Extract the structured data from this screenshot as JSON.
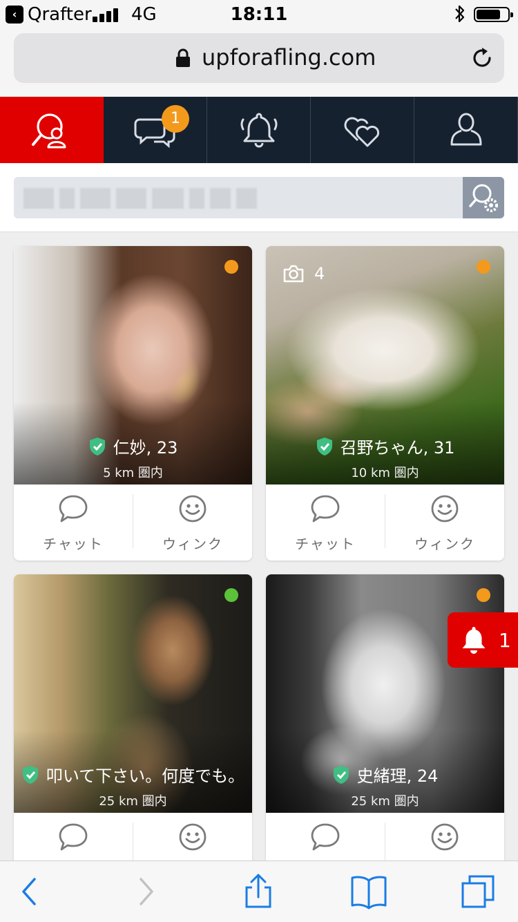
{
  "status_bar": {
    "back_app": "Qrafter",
    "network": "4G",
    "time": "18:11",
    "battery_level": 0.75
  },
  "browser": {
    "url": "upforafling.com"
  },
  "nav": {
    "tabs": [
      {
        "icon": "search-user-icon",
        "active": true
      },
      {
        "icon": "chat-bubbles-icon",
        "badge": "1"
      },
      {
        "icon": "bell-icon"
      },
      {
        "icon": "hearts-icon"
      },
      {
        "icon": "profile-icon"
      }
    ]
  },
  "profiles": [
    {
      "name_age": "仁妙, 23",
      "distance": "5 km 圏内",
      "online_status": "away",
      "status_color": "#f39a1c"
    },
    {
      "name_age": "召野ちゃん, 31",
      "distance": "10 km 圏内",
      "online_status": "away",
      "status_color": "#f39a1c",
      "photo_count": "4"
    },
    {
      "name_age": "叩いて下さい。何度でも。",
      "distance": "25 km 圏内",
      "online_status": "online",
      "status_color": "#5cc23a"
    },
    {
      "name_age": "史緒理, 24",
      "distance": "25 km 圏内",
      "online_status": "away",
      "status_color": "#f39a1c"
    }
  ],
  "actions": {
    "chat": "チャット",
    "wink": "ウィンク"
  },
  "notification": {
    "count": "1"
  },
  "colors": {
    "accent_red": "#e00000",
    "nav_bg": "#15212f",
    "badge_orange": "#f39a1c",
    "verified_green": "#3fbf83",
    "ios_blue": "#1a7ce5"
  }
}
